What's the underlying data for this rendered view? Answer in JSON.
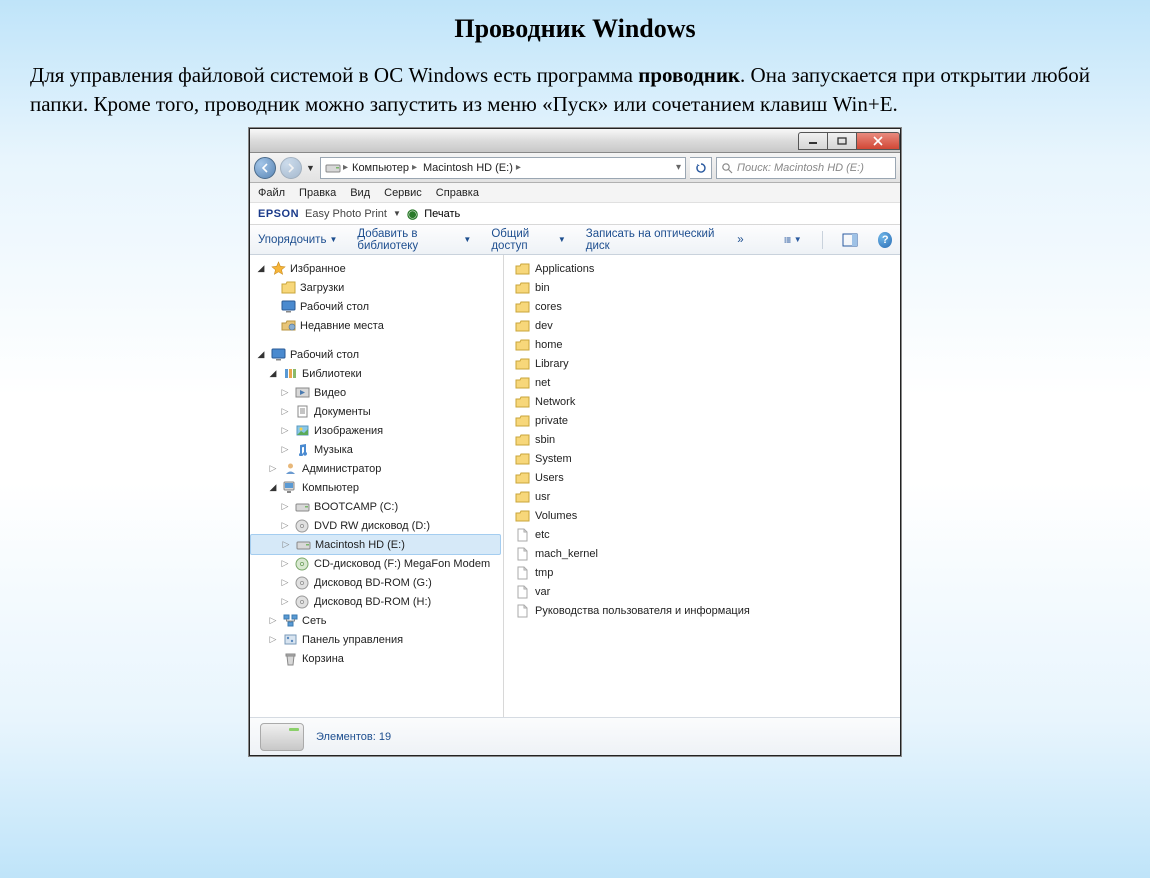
{
  "slide": {
    "title": "Проводник Windows",
    "paragraph_pre": "Для управления файловой системой в ОС Windows есть программа ",
    "paragraph_bold": "проводник",
    "paragraph_post": ". Она запускается при открытии любой папки. Кроме того, проводник можно запустить из меню «Пуск» или сочетанием клавиш Win+E."
  },
  "breadcrumb": {
    "seg1": "Компьютер",
    "seg2": "Macintosh HD (E:)"
  },
  "search": {
    "placeholder": "Поиск: Macintosh HD (E:)"
  },
  "menubar": {
    "file": "Файл",
    "edit": "Правка",
    "view": "Вид",
    "service": "Сервис",
    "help": "Справка"
  },
  "epson": {
    "logo": "EPSON",
    "text": "Easy Photo Print",
    "print": "Печать"
  },
  "toolbar": {
    "organize": "Упорядочить",
    "add_library": "Добавить в библиотеку",
    "share": "Общий доступ",
    "burn": "Записать на оптический диск",
    "more": "»"
  },
  "tree": {
    "favorites": "Избранное",
    "downloads": "Загрузки",
    "desktop_fav": "Рабочий стол",
    "recent": "Недавние места",
    "desktop": "Рабочий стол",
    "libraries": "Библиотеки",
    "video": "Видео",
    "documents": "Документы",
    "pictures": "Изображения",
    "music": "Музыка",
    "admin": "Администратор",
    "computer": "Компьютер",
    "bootcamp": "BOOTCAMP (C:)",
    "dvdrw": "DVD RW дисковод (D:)",
    "macintosh": "Macintosh HD (E:)",
    "cdrom": "CD-дисковод (F:) MegaFon Modem",
    "bdg": "Дисковод BD-ROM (G:)",
    "bdh": "Дисковод BD-ROM (H:)",
    "network": "Сеть",
    "cpanel": "Панель управления",
    "trash": "Корзина"
  },
  "list": {
    "applications": "Applications",
    "bin": "bin",
    "cores": "cores",
    "dev": "dev",
    "home": "home",
    "library": "Library",
    "net": "net",
    "network": "Network",
    "private": "private",
    "sbin": "sbin",
    "system": "System",
    "users": "Users",
    "usr": "usr",
    "volumes": "Volumes",
    "etc": "etc",
    "mach": "mach_kernel",
    "tmp": "tmp",
    "var": "var",
    "guide": "Руководства пользователя и информация"
  },
  "status": {
    "text": "Элементов: 19"
  }
}
